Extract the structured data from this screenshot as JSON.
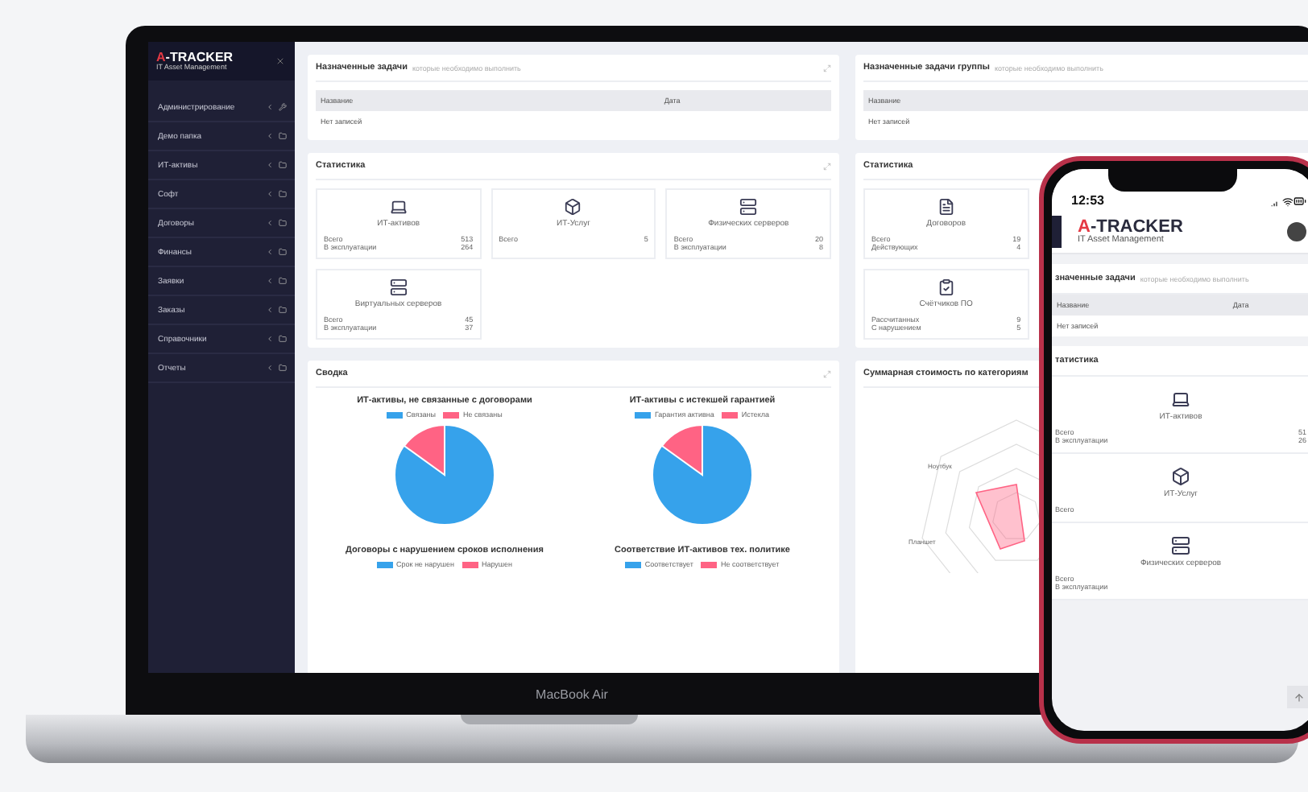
{
  "sidebar": {
    "logo": {
      "accent": "A",
      "rest": "-TRACKER",
      "subtitle": "IT Asset Management"
    },
    "items": [
      {
        "label": "Администрирование",
        "kind": "tool"
      },
      {
        "label": "Демо папка",
        "kind": "folder"
      },
      {
        "label": "ИТ-активы",
        "kind": "folder"
      },
      {
        "label": "Софт",
        "kind": "folder"
      },
      {
        "label": "Договоры",
        "kind": "folder"
      },
      {
        "label": "Финансы",
        "kind": "folder"
      },
      {
        "label": "Заявки",
        "kind": "folder"
      },
      {
        "label": "Заказы",
        "kind": "folder"
      },
      {
        "label": "Справочники",
        "kind": "folder"
      },
      {
        "label": "Отчеты",
        "kind": "folder"
      }
    ]
  },
  "tasks": {
    "title": "Назначенные задачи",
    "hint": "которые необходимо выполнить",
    "columns": [
      "Название",
      "Дата"
    ],
    "empty": "Нет записей"
  },
  "stats": {
    "title": "Статистика",
    "cards": [
      {
        "kind": "laptop",
        "title": "ИТ-активов",
        "rows": [
          {
            "label": "Всего",
            "value": "513"
          },
          {
            "label": "В эксплуатации",
            "value": "264"
          }
        ]
      },
      {
        "kind": "box",
        "title": "ИТ-Услуг",
        "rows": [
          {
            "label": "Всего",
            "value": "5"
          }
        ]
      },
      {
        "kind": "server",
        "title": "Физических серверов",
        "rows": [
          {
            "label": "Всего",
            "value": "20"
          },
          {
            "label": "В эксплуатации",
            "value": "8"
          }
        ]
      },
      {
        "kind": "server",
        "title": "Виртуальных серверов",
        "rows": [
          {
            "label": "Всего",
            "value": "45"
          },
          {
            "label": "В эксплуатации",
            "value": "37"
          }
        ]
      }
    ]
  },
  "summary": {
    "title": "Сводка",
    "charts": [
      {
        "title": "ИТ-активы, не связанные с договорами",
        "pie_visible": true,
        "legend": [
          {
            "label": "Связаны",
            "color": "#36a2eb"
          },
          {
            "label": "Не связаны",
            "color": "#ff6384"
          }
        ]
      },
      {
        "title": "ИТ-активы с истекшей гарантией",
        "pie_visible": true,
        "legend": [
          {
            "label": "Гарантия активна",
            "color": "#36a2eb"
          },
          {
            "label": "Истекла",
            "color": "#ff6384"
          }
        ]
      },
      {
        "title": "Договоры с нарушением сроков исполнения",
        "pie_visible": false,
        "legend": [
          {
            "label": "Срок не нарушен",
            "color": "#36a2eb"
          },
          {
            "label": "Нарушен",
            "color": "#ff6384"
          }
        ]
      },
      {
        "title": "Соответствие ИТ-активов тех. политике",
        "pie_visible": false,
        "legend": [
          {
            "label": "Соответствует",
            "color": "#36a2eb"
          },
          {
            "label": "Не соответствует",
            "color": "#ff6384"
          }
        ]
      }
    ]
  },
  "group_tasks": {
    "title": "Назначенные задачи группы",
    "hint": "которые необходимо выполнить",
    "columns": [
      "Название"
    ],
    "empty": "Нет записей"
  },
  "group_stats": {
    "title": "Статистика",
    "cards": [
      {
        "kind": "document",
        "title": "Договоров",
        "rows": [
          {
            "label": "Всего",
            "value": "19"
          },
          {
            "label": "Действующих",
            "value": "4"
          }
        ]
      },
      {
        "kind": "clipboard",
        "title": "Счётчиков ПО",
        "rows": [
          {
            "label": "Рассчитанных",
            "value": "9"
          },
          {
            "label": "С нарушением",
            "value": "5"
          }
        ]
      }
    ]
  },
  "cost": {
    "title": "Суммарная стоимость по категориям",
    "axis_labels": [
      "Ноутбук",
      "Планшет"
    ]
  },
  "device_label": "MacBook Air",
  "phone": {
    "time": "12:53",
    "logo": {
      "accent": "A",
      "rest": "-TRACKER",
      "subtitle": "IT Asset Management"
    },
    "tasks": {
      "title": "значенные задачи",
      "hint": "которые необходимо выполнить",
      "columns": [
        "Название",
        "Дата"
      ],
      "empty": "Нет записей"
    },
    "stats": {
      "title": "татистика",
      "cards": [
        {
          "kind": "laptop",
          "title": "ИТ-активов",
          "rows": [
            {
              "label": "Всего",
              "value": "51"
            },
            {
              "label": "В эксплуатации",
              "value": "26"
            }
          ]
        },
        {
          "kind": "box",
          "title": "ИТ-Услуг",
          "rows": [
            {
              "label": "Всего"
            }
          ]
        },
        {
          "kind": "server",
          "title": "Физических серверов",
          "rows": [
            {
              "label": "Всего"
            },
            {
              "label": "В эксплуатации"
            }
          ]
        }
      ]
    }
  }
}
